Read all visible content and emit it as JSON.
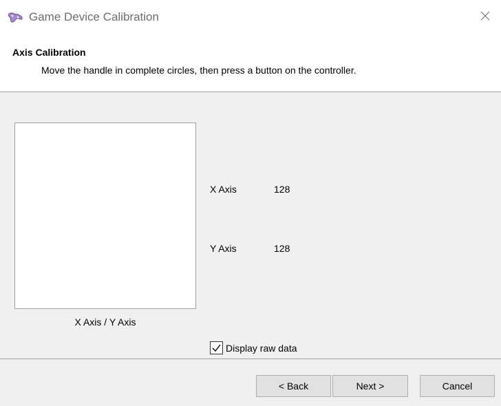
{
  "window": {
    "title": "Game Device Calibration",
    "icon": "gamepad-icon",
    "close_icon": "close-icon"
  },
  "header": {
    "title": "Axis Calibration",
    "subtitle": "Move the handle in complete circles, then press a button on the controller."
  },
  "calibration": {
    "plot_label": "X Axis / Y Axis",
    "axes": [
      {
        "label": "X Axis",
        "value": "128"
      },
      {
        "label": "Y Axis",
        "value": "128"
      }
    ],
    "raw_data": {
      "label": "Display raw data",
      "checked": true
    }
  },
  "buttons": {
    "back": "< Back",
    "next": "Next >",
    "cancel": "Cancel"
  }
}
